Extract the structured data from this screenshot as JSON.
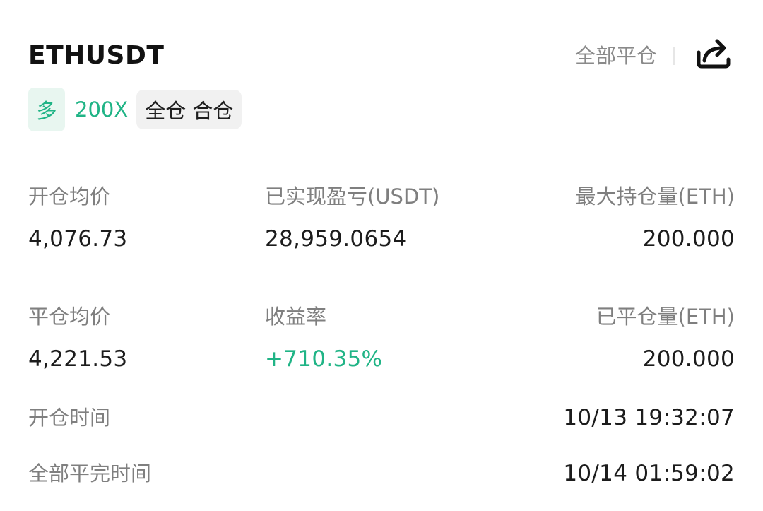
{
  "header": {
    "symbol": "ETHUSDT",
    "close_all_label": "全部平仓",
    "share_icon": "share-icon"
  },
  "tags": {
    "side": "多",
    "leverage": "200X",
    "margin_mode": "全仓 合仓"
  },
  "stats": {
    "open_avg_price_label": "开仓均价",
    "open_avg_price_value": "4,076.73",
    "realized_pnl_label": "已实现盈亏(USDT)",
    "realized_pnl_value": "28,959.0654",
    "max_position_label": "最大持仓量(ETH)",
    "max_position_value": "200.000",
    "close_avg_price_label": "平仓均价",
    "close_avg_price_value": "4,221.53",
    "roi_label": "收益率",
    "roi_value": "+710.35%",
    "closed_qty_label": "已平仓量(ETH)",
    "closed_qty_value": "200.000",
    "open_time_label": "开仓时间",
    "open_time_value": "10/13 19:32:07",
    "full_close_time_label": "全部平完时间",
    "full_close_time_value": "10/14 01:59:02"
  },
  "colors": {
    "accent_green": "#20b486",
    "tag_bg": "#e8f6f0",
    "label_gray": "#7f7f7f"
  }
}
